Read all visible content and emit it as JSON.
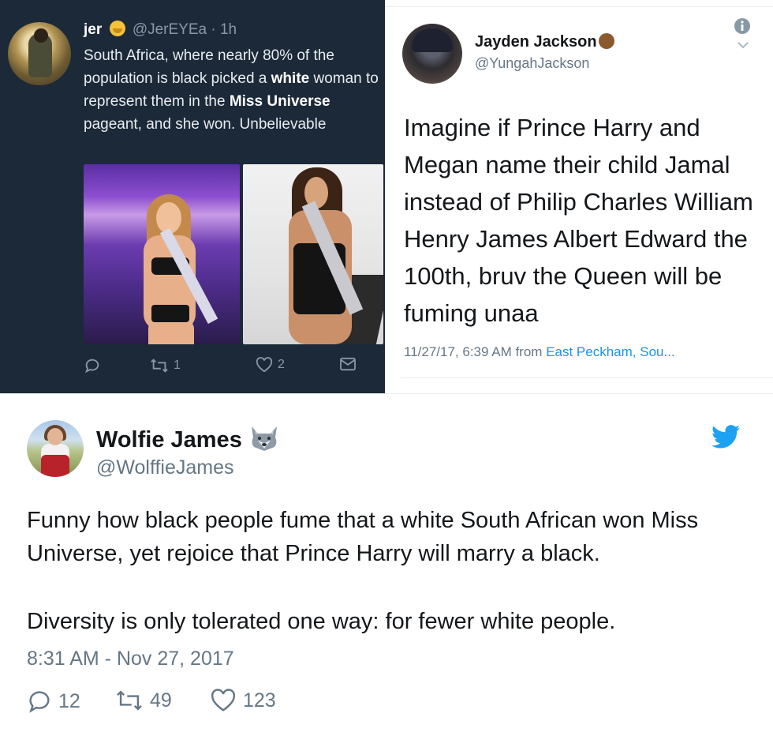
{
  "dark_tweet": {
    "name": "jer",
    "name_emoji": "hugging-face-emoji",
    "handle": "@JerEYEa",
    "separator": "·",
    "time": "1h",
    "body": {
      "part1": "South Africa, where nearly 80% of the population is black picked a ",
      "bold1": "white",
      "part2": " woman to represent them in the ",
      "bold2": "Miss Universe",
      "part3": " pageant, and she won. Unbelievable"
    },
    "actions": {
      "reply_icon": "reply-icon",
      "retweet_count": "1",
      "like_count": "2",
      "dm_icon": "envelope-icon"
    },
    "colors": {
      "background": "#1c2938",
      "muted": "#8899a6"
    }
  },
  "light_tweet": {
    "name": "Jayden Jackson",
    "name_emoji": "dark-skin-face-emoji",
    "handle": "@YungahJackson",
    "body": "Imagine if Prince Harry and Megan name their child Jamal instead of Philip Charles William Henry James Albert Edward the 100th, bruv the Queen will be fuming unaa",
    "meta_time": "11/27/17, 6:39 AM from ",
    "meta_location": "East Peckham, Sou..."
  },
  "wolfie_tweet": {
    "name": "Wolfie James",
    "name_emoji": "wolf-emoji",
    "handle": "@WolffieJames",
    "body_line1": "Funny how black people fume that a white South African won Miss Universe, yet rejoice that Prince Harry will marry a black.",
    "body_line2": "Diversity is only tolerated one way: for fewer white people.",
    "timestamp": "8:31 AM - Nov 27, 2017",
    "actions": {
      "reply_count": "12",
      "retweet_count": "49",
      "like_count": "123"
    },
    "colors": {
      "twitter_blue": "#1da1f2",
      "muted": "#657786"
    }
  }
}
